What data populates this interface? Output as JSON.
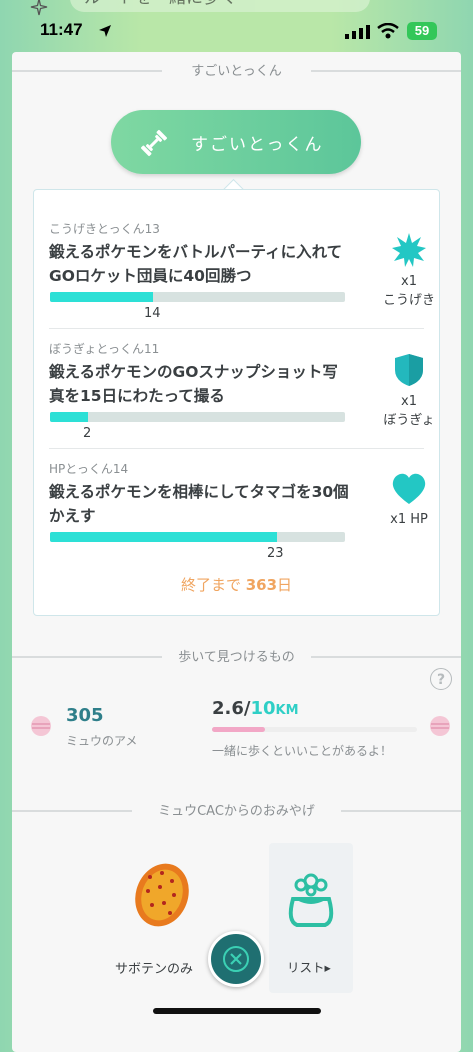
{
  "status_bar": {
    "time": "11:47",
    "battery": "59"
  },
  "top_ghost_text": "ルートを一緒に歩く",
  "section_training": {
    "header": "すごいとっくん",
    "button_label": "すごいとっくん"
  },
  "tasks": [
    {
      "category": "こうげきとっくん13",
      "description": "鍛えるポケモンをバトルパーティに入れてGOロケット団員に40回勝つ",
      "progress_count": "14",
      "progress_fraction": 0.35,
      "reward_amount": "x1",
      "reward_name": "こうげき",
      "reward_icon": "burst-icon"
    },
    {
      "category": "ぼうぎょとっくん11",
      "description": "鍛えるポケモンのGOスナップショット写真を15日にわたって撮る",
      "progress_count": "2",
      "progress_fraction": 0.13,
      "reward_amount": "x1",
      "reward_name": "ぼうぎょ",
      "reward_icon": "shield-icon"
    },
    {
      "category": "HPとっくん14",
      "description": "鍛えるポケモンを相棒にしてタマゴを30個かえす",
      "progress_count": "23",
      "progress_fraction": 0.77,
      "reward_amount": "x1 HP",
      "reward_name": "",
      "reward_icon": "heart-icon"
    }
  ],
  "remaining": {
    "prefix": "終了まで ",
    "days": "363",
    "suffix": "日"
  },
  "section_walk": {
    "header": "歩いて見つけるもの"
  },
  "buddy": {
    "candy_count": "305",
    "candy_name": "ミュウのアメ",
    "distance_current": "2.6",
    "distance_sep": "/",
    "distance_target": "10",
    "distance_unit": "KM",
    "distance_fraction": 0.26,
    "message": "一緒に歩くといいことがあるよ！"
  },
  "section_souvenir": {
    "header": "ミュウCACからのおみやげ"
  },
  "souvenir": {
    "item_label": "サボテンのみ",
    "list_label": "リスト▸"
  },
  "colors": {
    "accent": "#2de0d6",
    "button": "#6fd09e",
    "remaining": "#f0a560"
  }
}
